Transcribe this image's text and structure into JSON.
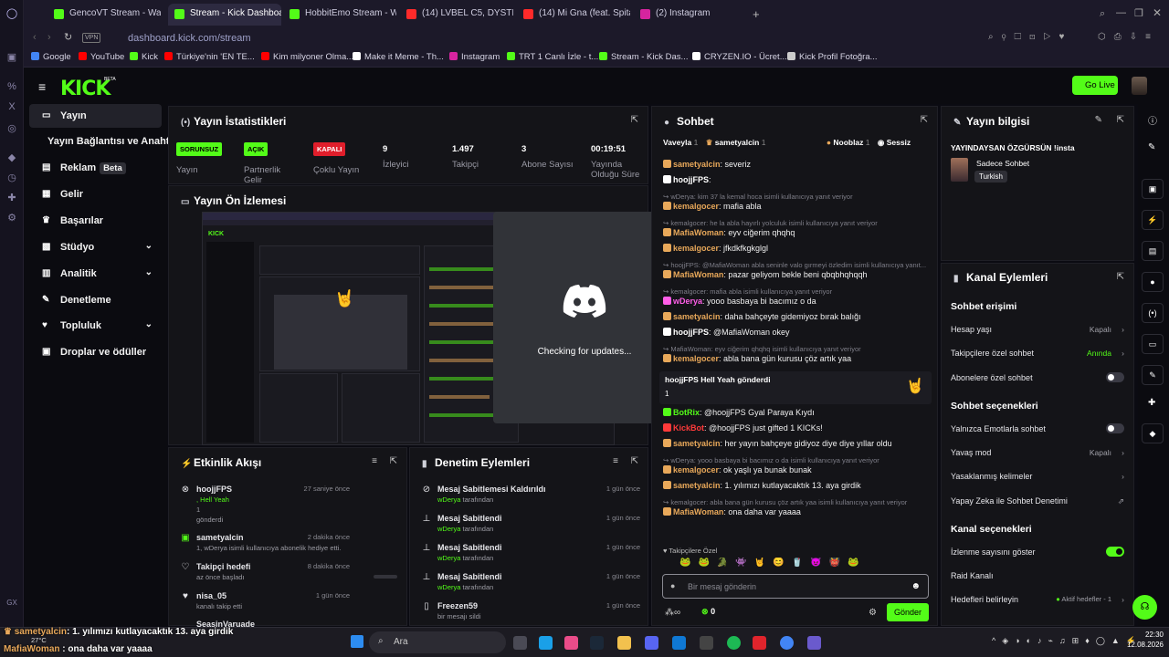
{
  "browser": {
    "tabs": [
      {
        "label": "GencoVT Stream - Watch L",
        "color": "#53fc18"
      },
      {
        "label": "Stream - Kick Dashboard",
        "color": "#53fc18"
      },
      {
        "label": "HobbitEmo Stream - Watc",
        "color": "#53fc18"
      },
      {
        "label": "(14) LVBEL C5, DYSTINCT",
        "color": "#ff2a2a"
      },
      {
        "label": "(14) Mi Gna (feat. Spitakci",
        "color": "#ff2a2a"
      },
      {
        "label": "(2) Instagram",
        "color": "#d6249f"
      }
    ],
    "new_tab": "+",
    "vpn": "VPN",
    "url": "dashboard.kick.com/stream",
    "bookmarks": [
      {
        "label": "Google",
        "color": "#4285f4"
      },
      {
        "label": "YouTube",
        "color": "#ff0000"
      },
      {
        "label": "Kick",
        "color": "#53fc18"
      },
      {
        "label": "Türkiye'nin 'EN TE...",
        "color": "#ff0000"
      },
      {
        "label": "Kim milyoner Olma...",
        "color": "#ff0000"
      },
      {
        "label": "Make it Meme - Th...",
        "color": "#ffffff"
      },
      {
        "label": "Instagram",
        "color": "#d6249f"
      },
      {
        "label": "TRT 1 Canlı İzle - t...",
        "color": "#53fc18"
      },
      {
        "label": "Stream - Kick Das...",
        "color": "#53fc18"
      },
      {
        "label": "CRYZEN.IO - Ücret...",
        "color": "#ffffff"
      },
      {
        "label": "Kick Profil Fotoğra...",
        "color": "#cccccc"
      }
    ]
  },
  "header": {
    "logo": "KICK",
    "logo_beta": "BETA",
    "go_live": "Go Live"
  },
  "nav": {
    "items": [
      {
        "label": "Yayın",
        "icon": "broadcast-icon"
      },
      {
        "label": "Yayın Bağlantısı ve Anahtarı",
        "icon": ""
      },
      {
        "label": "Reklam",
        "badge": "Beta",
        "icon": "ad-icon"
      },
      {
        "label": "Gelir",
        "icon": "revenue-icon"
      },
      {
        "label": "Başarılar",
        "icon": "trophy-icon"
      },
      {
        "label": "Stüdyo",
        "icon": "studio-icon"
      },
      {
        "label": "Analitik",
        "icon": "analytics-icon"
      },
      {
        "label": "Denetleme",
        "icon": "wrench-icon"
      },
      {
        "label": "Topluluk",
        "icon": "community-icon"
      },
      {
        "label": "Droplar ve ödüller",
        "icon": "drops-icon"
      }
    ]
  },
  "stats": {
    "title": "Yayın İstatistikleri",
    "items": [
      {
        "badge": "SORUNSUZ",
        "badge_color": "#53fc18",
        "label": "Yayın"
      },
      {
        "badge": "AÇIK",
        "badge_color": "#53fc18",
        "label": "Partnerlik Gelir"
      },
      {
        "badge": "KAPALI",
        "badge_color": "#e01e2b",
        "label": "Çoklu Yayın"
      },
      {
        "value": "9",
        "label": "İzleyici"
      },
      {
        "value": "1.497",
        "label": "Takipçi"
      },
      {
        "value": "3",
        "label": "Abone Sayısı"
      },
      {
        "value": "00:19:51",
        "label": "Yayında Olduğu Süre"
      }
    ]
  },
  "preview": {
    "title": "Yayın Ön İzlemesi"
  },
  "discord": {
    "text": "Checking for updates..."
  },
  "activity": {
    "title": "Etkinlik Akışı",
    "items": [
      {
        "user": "hoojjFPS",
        "line2": ", Hell Yeah",
        "line3": "1",
        "line4": "gönderdi",
        "time": "27 saniye önce"
      },
      {
        "user": "sametyalcin",
        "line2": "1, wDerya isimli kullanıcıya abonelik hediye etti.",
        "time": "2 dakika önce"
      },
      {
        "user": "Takipçi hedefi",
        "line2": "az önce başladı",
        "time": "8 dakika önce"
      },
      {
        "user": "nisa_05",
        "line2": "kanalı takip etti",
        "time": "1 gün önce"
      },
      {
        "user": "SeasinVaruade",
        "line2": "",
        "time": ""
      }
    ]
  },
  "moderation": {
    "title": "Denetim Eylemleri",
    "items": [
      {
        "title": "Mesaj Sabitlemesi Kaldırıldı",
        "by": "wDerya",
        "suffix": "tarafından",
        "time": "1 gün önce"
      },
      {
        "title": "Mesaj Sabitlendi",
        "by": "wDerya",
        "suffix": "tarafından",
        "time": "1 gün önce"
      },
      {
        "title": "Mesaj Sabitlendi",
        "by": "wDerya",
        "suffix": "tarafından",
        "time": "1 gün önce"
      },
      {
        "title": "Mesaj Sabitlendi",
        "by": "wDerya",
        "suffix": "tarafından",
        "time": "1 gün önce"
      },
      {
        "title": "Freezen59",
        "by": "",
        "suffix": "bir mesajı sildi",
        "time": "1 gün önce"
      }
    ]
  },
  "chat": {
    "title": "Sohbet",
    "top_users": [
      {
        "name": "Vaveyla",
        "count": "1"
      },
      {
        "name": "sametyalcin",
        "count": "1"
      },
      {
        "name": "Nooblaz",
        "count": "1"
      }
    ],
    "mode": "Sessiz",
    "messages": [
      {
        "kind": "msg",
        "user": "sametyalcin",
        "color": "#e8a85a",
        "text": ": severiz"
      },
      {
        "kind": "msg",
        "user": "hoojjFPS",
        "color": "#ffffff",
        "text": ":"
      },
      {
        "kind": "reply",
        "text": "↪ wDerya: kim 37 la kemal hoca isimli kullanıcıya yanıt veriyor"
      },
      {
        "kind": "msg",
        "user": "kemalgocer",
        "color": "#e8a85a",
        "text": ": mafia abla"
      },
      {
        "kind": "reply",
        "text": "↪ kemalgocer: he la abla hayırlı yolculuk isimli kullanıcıya yanıt veriyor"
      },
      {
        "kind": "msg",
        "user": "MafiaWoman",
        "color": "#e8a85a",
        "text": ": eyv ciğerim qhqhq"
      },
      {
        "kind": "msg",
        "user": "kemalgocer",
        "color": "#e8a85a",
        "text": ": jfkdkfkgkglgl"
      },
      {
        "kind": "reply",
        "text": "↪ hoojjFPS: @MafiaWoman abla seninle valo gırmeyi özledim isimli kullanıcıya yanıt..."
      },
      {
        "kind": "msg",
        "user": "MafiaWoman",
        "color": "#e8a85a",
        "text": ": pazar geliyom bekle beni qbqbhqhqqh"
      },
      {
        "kind": "reply",
        "text": "↪ kemalgocer: mafia abla isimli kullanıcıya yanıt veriyor"
      },
      {
        "kind": "msg",
        "user": "wDerya",
        "color": "#ff5ee8",
        "text": ": yooo basbaya bi bacımız o da"
      },
      {
        "kind": "msg",
        "user": "sametyalcin",
        "color": "#e8a85a",
        "text": ": daha bahçeyte gidemiyoz bırak balığı"
      },
      {
        "kind": "msg",
        "user": "hoojjFPS",
        "color": "#ffffff",
        "text": ": @MafiaWoman okey"
      },
      {
        "kind": "reply",
        "text": "↪ MafiaWoman: eyv ciğerim qhqhq isimli kullanıcıya yanıt veriyor"
      },
      {
        "kind": "msg",
        "user": "kemalgocer",
        "color": "#e8a85a",
        "text": ": abla bana gün kurusu çöz artık yaa"
      },
      {
        "kind": "gift",
        "text": "hoojjFPS Hell Yeah gönderdi",
        "count": "1"
      },
      {
        "kind": "msg",
        "user": "BotRix",
        "color": "#53fc18",
        "text": ": @hoojjFPS Gyal Paraya Kıydı"
      },
      {
        "kind": "msg",
        "user": "KickBot",
        "color": "#ff3a3a",
        "text": ": @hoojjFPS just gifted 1 KICKs!"
      },
      {
        "kind": "msg",
        "user": "sametyalcin",
        "color": "#e8a85a",
        "text": ": her yayın bahçeye gidiyoz diye diye yıllar oldu"
      },
      {
        "kind": "reply",
        "text": "↪ wDerya: yooo basbaya bi bacımız o da isimli kullanıcıya yanıt veriyor"
      },
      {
        "kind": "msg",
        "user": "kemalgocer",
        "color": "#e8a85a",
        "text": ": ok yaşlı ya bunak bunak"
      },
      {
        "kind": "msg",
        "user": "sametyalcin",
        "color": "#e8a85a",
        "text": ": 1. yılımızı kutlayacaktık 13. aya girdik"
      },
      {
        "kind": "reply",
        "text": "↪ kemalgocer: abla bana gün kurusu çöz artık yaa isimli kullanıcıya yanıt veriyor"
      },
      {
        "kind": "msg",
        "user": "MafiaWoman",
        "color": "#e8a85a",
        "text": ": ona daha var yaaaa"
      }
    ],
    "emote_section": "Takipçilere Özel",
    "placeholder": "Bir mesaj gönderin",
    "points": "0",
    "send": "Gönder"
  },
  "info": {
    "title": "Yayın bilgisi",
    "stream_title": "YAYINDAYSAN ÖZGÜRSÜN !insta",
    "category": "Sadece Sohbet",
    "tag": "Turkish"
  },
  "channel": {
    "title": "Kanal Eylemleri",
    "chat_access": "Sohbet erişimi",
    "account_age": "Hesap yaşı",
    "account_age_value": "Kapalı",
    "followers_only": "Takipçilere özel sohbet",
    "followers_only_value": "Anında",
    "subs_only": "Abonelere özel sohbet",
    "chat_options": "Sohbet seçenekleri",
    "emotes_only": "Yalnızca Emotlarla sohbet",
    "slow_mode": "Yavaş mod",
    "slow_mode_value": "Kapalı",
    "banned_words": "Yasaklanmış kelimeler",
    "ai_mod": "Yapay Zeka ile Sohbet Denetimi",
    "channel_options": "Kanal seçenekleri",
    "show_viewers": "İzlenme sayısını göster",
    "raid": "Raid Kanalı",
    "goals": "Hedefleri belirleyin",
    "goals_value": "Aktif hedefler - 1"
  },
  "overlay": {
    "line1_user": "sametyalcin",
    "line1_text": ": 1. yılımızı kutlayacaktık 13. aya girdik",
    "line2_user": "MafiaWoman",
    "line2_text": " : ona daha var yaaaa"
  },
  "taskbar": {
    "search": "Ara",
    "temp": "27°C",
    "time": "22:30",
    "date": "12.08.2026"
  },
  "colors": {
    "kick_green": "#53fc18",
    "panel": "#141418",
    "bg": "#0b0b10"
  }
}
